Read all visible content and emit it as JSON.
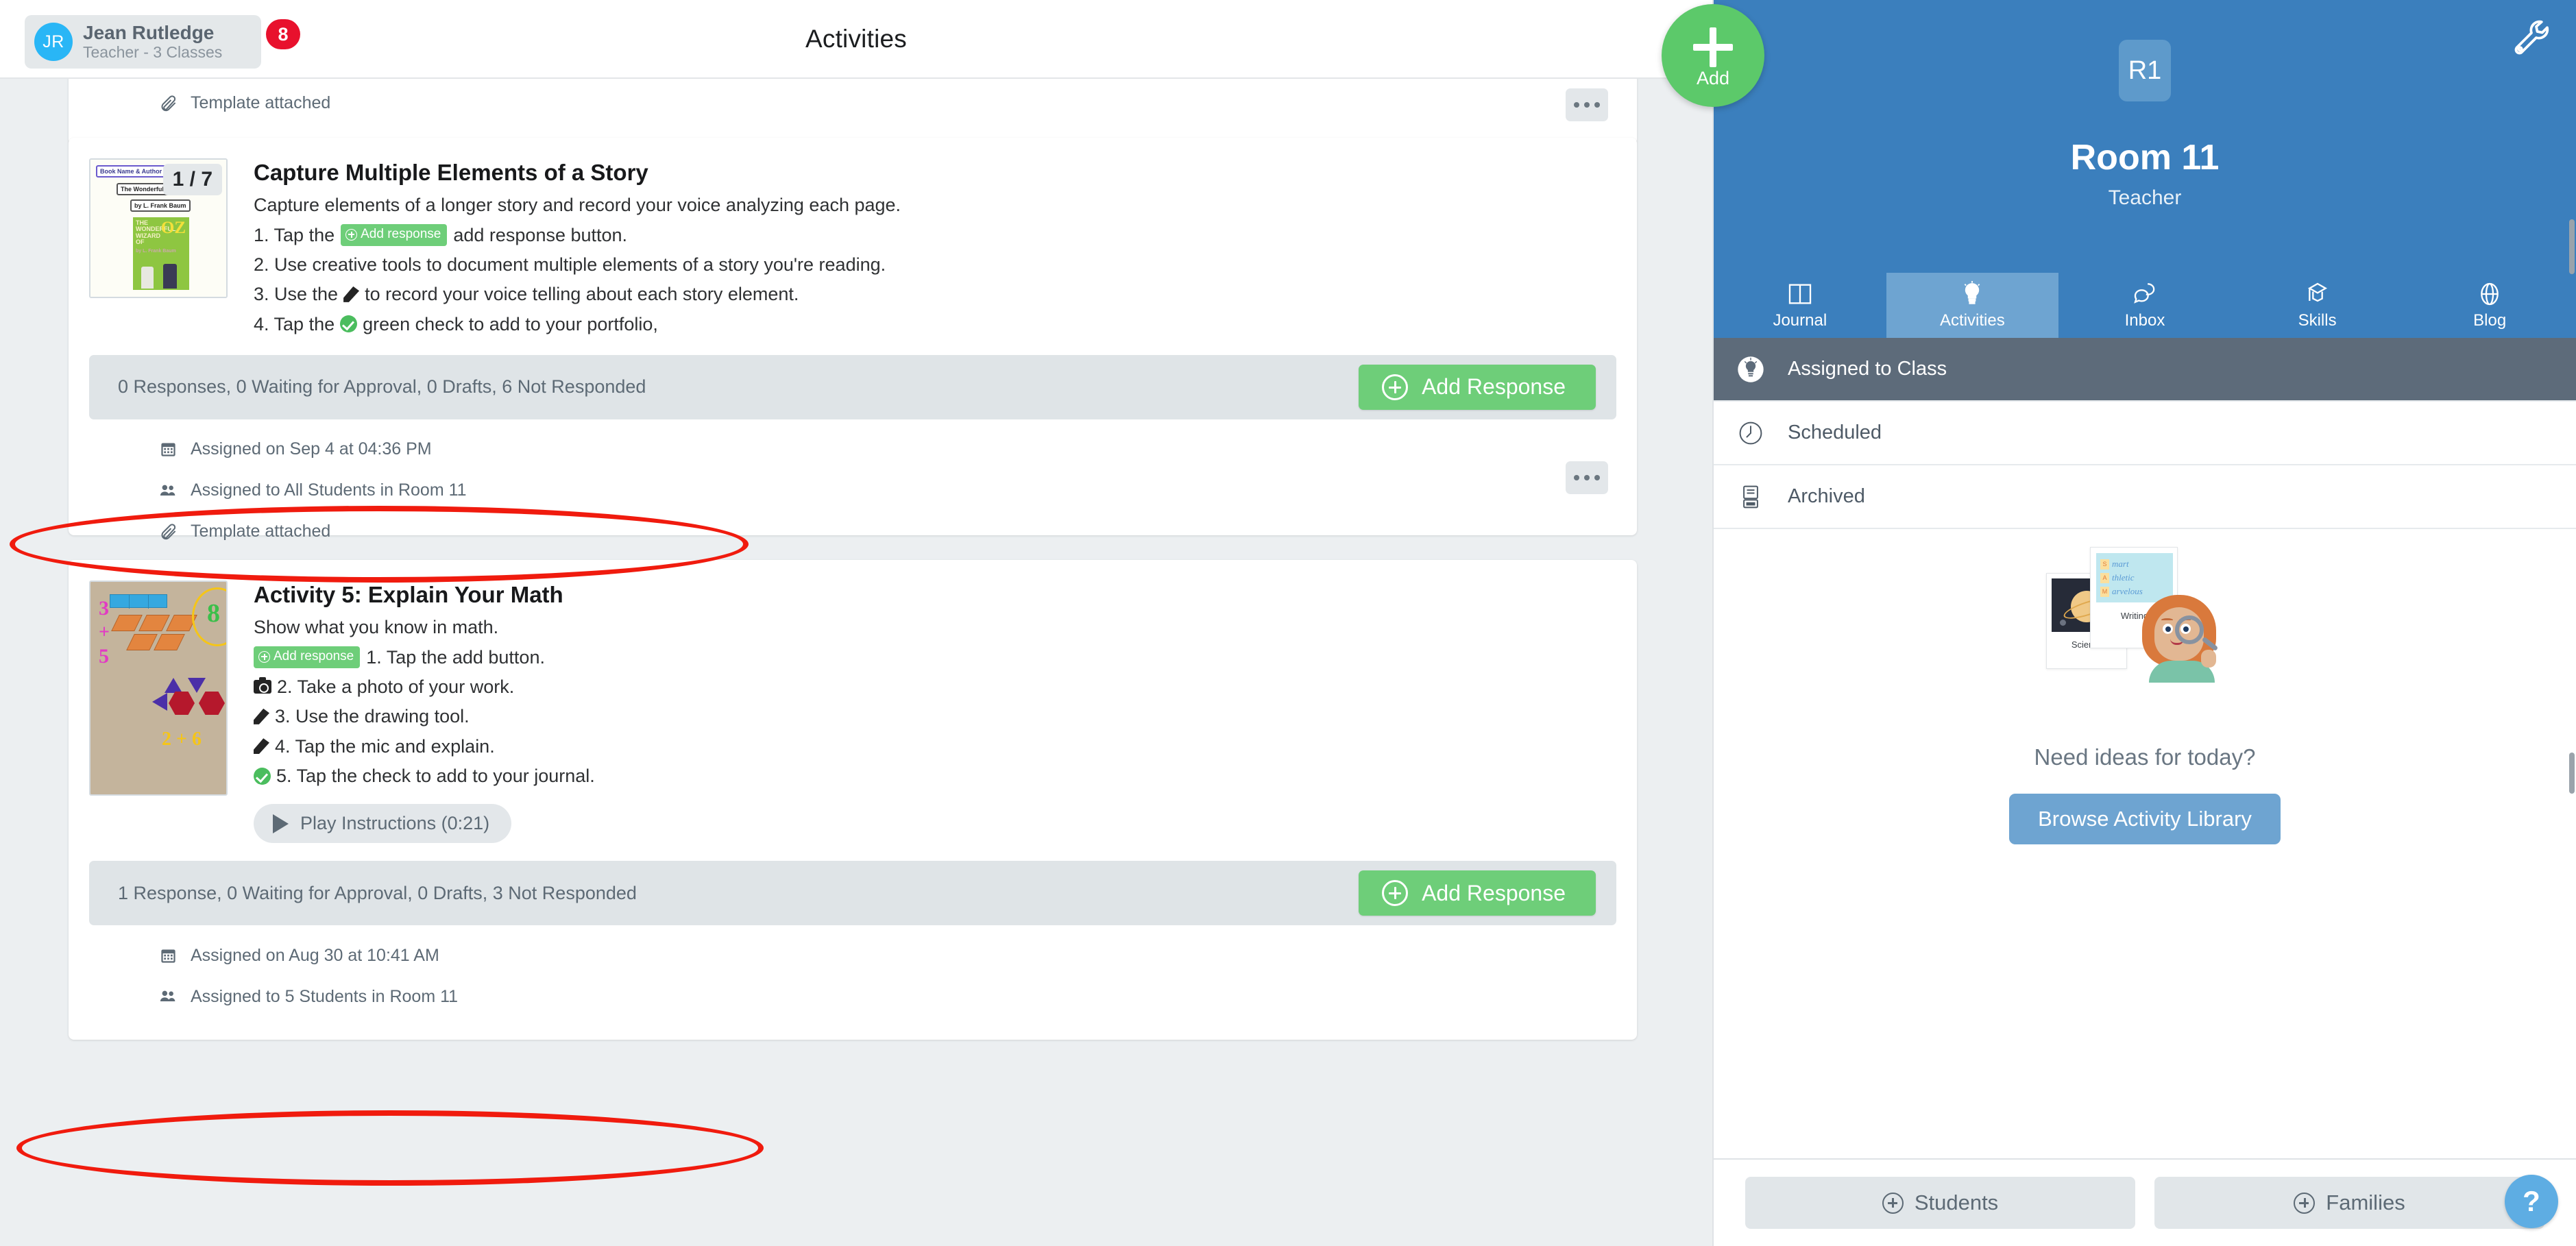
{
  "topbar": {
    "user_initials": "JR",
    "user_name": "Jean Rutledge",
    "user_role": "Teacher - 3 Classes",
    "badge_count": "8",
    "page_title": "Activities"
  },
  "fab": {
    "label": "Add",
    "icon": "plus-icon"
  },
  "activities": [
    {
      "partial": true,
      "meta": [
        {
          "icon": "paperclip-icon",
          "text": "Template attached"
        }
      ]
    },
    {
      "page_chip": "1 / 7",
      "thumbnail": {
        "type": "book-template",
        "label_top": "Book Name & Author",
        "line1": "The Wonderful Wizard of Oz",
        "line2": "by L. Frank Baum",
        "cover_title": "THE WONDERFUL WIZARD OF",
        "cover_big": "OZ",
        "cover_sub": "by L. Frank Baum"
      },
      "title": "Capture Multiple Elements of a Story",
      "description": "Capture elements of a longer story and record your voice analyzing each page.",
      "steps": [
        {
          "pre": "1. Tap the",
          "chip": "Add response",
          "post": "add response button."
        },
        {
          "pre": "2. Use creative tools to document multiple elements of a story you're reading.",
          "chip": null,
          "post": ""
        },
        {
          "pre": "3. Use the",
          "icon": "mic-icon",
          "post": "to record your voice telling about each story element."
        },
        {
          "pre": "4. Tap the",
          "icon": "green-check-icon",
          "post": "green check to add to your portfolio,"
        }
      ],
      "response_summary": "0 Responses, 0 Waiting for Approval, 0 Drafts, 6 Not Responded",
      "add_response_label": "Add Response",
      "highlighted": true,
      "meta": [
        {
          "icon": "calendar-icon",
          "text": "Assigned on Sep 4 at 04:36 PM"
        },
        {
          "icon": "people-icon",
          "text": "Assigned to All Students in Room 11"
        },
        {
          "icon": "paperclip-icon",
          "text": "Template attached"
        }
      ]
    },
    {
      "page_chip": null,
      "thumbnail": {
        "type": "math-photo",
        "marks": [
          "3",
          "+",
          "5",
          "8",
          "2 + 6"
        ]
      },
      "title": "Activity 5: Explain Your Math",
      "description": "Show what you know in math.",
      "steps": [
        {
          "chip": "Add response",
          "post": "1. Tap the add button."
        },
        {
          "icon": "camera-icon",
          "post": "2. Take a photo of your work."
        },
        {
          "icon": "pencil-icon",
          "post": "3. Use the drawing tool."
        },
        {
          "icon": "mic-icon",
          "post": "4. Tap the mic and explain."
        },
        {
          "icon": "green-check-icon",
          "post": "5. Tap the check to add to your journal."
        }
      ],
      "play_button": "Play Instructions (0:21)",
      "response_summary": "1 Response, 0 Waiting for Approval, 0 Drafts, 3 Not Responded",
      "add_response_label": "Add Response",
      "highlighted": true,
      "meta": [
        {
          "icon": "calendar-icon",
          "text": "Assigned on Aug 30 at 10:41 AM"
        },
        {
          "icon": "people-icon",
          "text": "Assigned to 5 Students in Room 11"
        }
      ]
    }
  ],
  "sidebar": {
    "room_initials": "R1",
    "room_name": "Room 11",
    "room_role": "Teacher",
    "settings_icon": "wrench-icon",
    "tabs": [
      {
        "label": "Journal",
        "icon": "book-icon",
        "active": false
      },
      {
        "label": "Activities",
        "icon": "lightbulb-icon",
        "active": true
      },
      {
        "label": "Inbox",
        "icon": "chat-icon",
        "active": false
      },
      {
        "label": "Skills",
        "icon": "graduation-cap-icon",
        "active": false
      },
      {
        "label": "Blog",
        "icon": "globe-icon",
        "active": false
      }
    ],
    "items": [
      {
        "label": "Assigned to Class",
        "icon": "lightbulb-icon",
        "active": true
      },
      {
        "label": "Scheduled",
        "icon": "clock-icon",
        "active": false
      },
      {
        "label": "Archived",
        "icon": "archive-icon",
        "active": false
      }
    ],
    "empty_state": {
      "illustration_captions": {
        "science": "Science",
        "writing": "Writing"
      },
      "illustration_words": [
        {
          "letter": "S",
          "word": "mart"
        },
        {
          "letter": "A",
          "word": "thletic"
        },
        {
          "letter": "M",
          "word": "arvelous"
        }
      ],
      "title": "Need ideas for today?",
      "button": "Browse Activity Library"
    },
    "footer": {
      "students_label": "Students",
      "families_label": "Families",
      "help_label": "?"
    }
  },
  "colors": {
    "accent_blue": "#3b7fbd",
    "green": "#6ece79",
    "badge_red": "#e8112d",
    "annotation_red": "#f01b0e",
    "panel_gray": "#dfe4e7"
  }
}
